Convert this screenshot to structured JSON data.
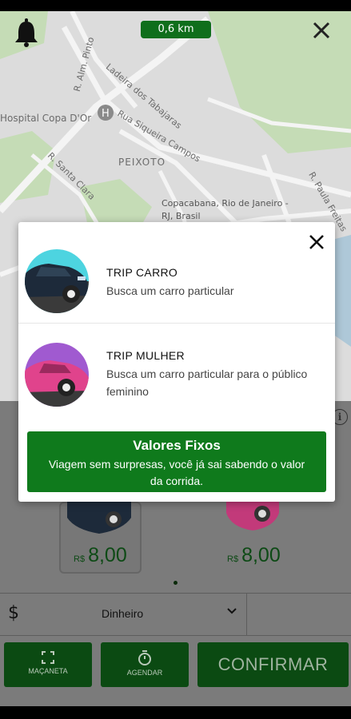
{
  "map": {
    "distance": "0,6 km",
    "labels": {
      "hospital": "Hospital Copa D'Or",
      "street_alm_pinto": "R. Alm. Pinto",
      "street_tabajaras": "Ladeira dos Tabajaras",
      "street_siqueira": "Rua Siqueira Campos",
      "district": "PEIXOTO",
      "street_santa_clara": "R. Santa Clara",
      "street_paula_freitas": "R. Paula Freitas",
      "area_line1": "Copacabana, Rio de Janeiro -",
      "area_line2": "RJ, Brasil"
    }
  },
  "modal": {
    "options": [
      {
        "title": "TRIP CARRO",
        "description": "Busca um carro particular"
      },
      {
        "title": "TRIP MULHER",
        "description": "Busca um carro particular para o público feminino"
      }
    ],
    "banner": {
      "title": "Valores Fixos",
      "description": "Viagem sem surpresas, você já sai sabendo o valor da corrida."
    }
  },
  "cards": [
    {
      "currency": "R$",
      "price": "8,00"
    },
    {
      "currency": "R$",
      "price": "8,00"
    }
  ],
  "payment": {
    "method": "Dinheiro",
    "icon": "$"
  },
  "buttons": {
    "macaneta": "MAÇANETA",
    "agendar": "AGENDAR",
    "confirmar": "CONFIRMAR"
  },
  "colors": {
    "brand_green": "#0f7a1c",
    "dark_green": "#0b4a12",
    "trip_carro": "#4dd4e0",
    "trip_mulher": "#a05ad0"
  },
  "icons": [
    "bell-icon",
    "close-icon",
    "hospital-icon",
    "info-icon",
    "chevron-down-icon",
    "expand-icon",
    "timer-icon"
  ]
}
